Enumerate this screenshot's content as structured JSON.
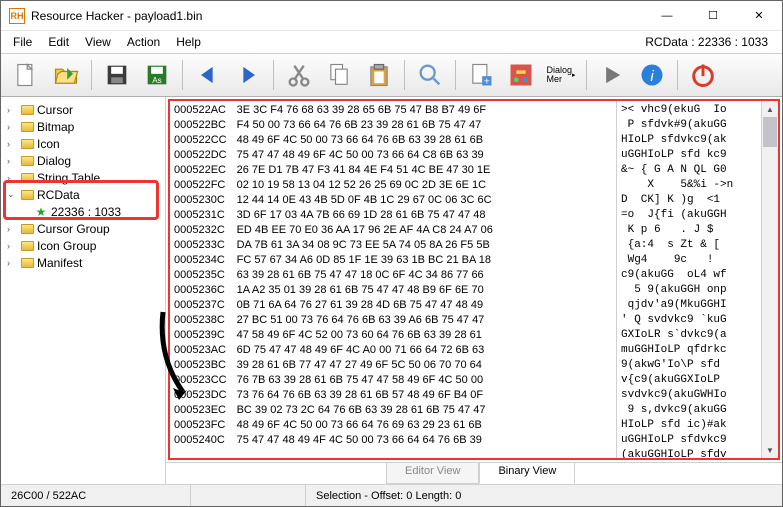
{
  "window": {
    "title": "Resource Hacker - payload1.bin",
    "path_right": "RCData : 22336 : 1033"
  },
  "menu": {
    "file": "File",
    "edit": "Edit",
    "view": "View",
    "action": "Action",
    "help": "Help"
  },
  "tree": {
    "items": [
      {
        "label": "Cursor"
      },
      {
        "label": "Bitmap"
      },
      {
        "label": "Icon"
      },
      {
        "label": "Dialog"
      },
      {
        "label": "String Table"
      },
      {
        "label": "RCData",
        "expanded": true,
        "children": [
          {
            "label": "22336 : 1033",
            "selected": true
          }
        ]
      },
      {
        "label": "Cursor Group"
      },
      {
        "label": "Icon Group"
      },
      {
        "label": "Manifest"
      }
    ]
  },
  "hex": {
    "addresses": [
      "000522AC",
      "000522BC",
      "000522CC",
      "000522DC",
      "000522EC",
      "000522FC",
      "0005230C",
      "0005231C",
      "0005232C",
      "0005233C",
      "0005234C",
      "0005235C",
      "0005236C",
      "0005237C",
      "0005238C",
      "0005239C",
      "000523AC",
      "000523BC",
      "000523CC",
      "000523DC",
      "000523EC",
      "000523FC",
      "0005240C"
    ],
    "bytes": [
      "3E 3C F4 76 68 63 39 28 65 6B 75 47 B8 B7 49 6F",
      "F4 50 00 73 66 64 76 6B 23 39 28 61 6B 75 47 47",
      "48 49 6F 4C 50 00 73 66 64 76 6B 63 39 28 61 6B",
      "75 47 47 48 49 6F 4C 50 00 73 66 64 C8 6B 63 39",
      "26 7E D1 7B 47 F3 41 84 4E F4 51 4C BE 47 30 1E",
      "02 10 19 58 13 04 12 52 26 25 69 0C 2D 3E 6E 1C",
      "12 44 14 0E 43 4B 5D 0F 4B 1C 29 67 0C 06 3C 6C",
      "3D 6F 17 03 4A 7B 66 69 1D 28 61 6B 75 47 47 48",
      "ED 4B EE 70 E0 36 AA 17 96 2E AF 4A C8 24 A7 06",
      "DA 7B 61 3A 34 08 9C 73 EE 5A 74 05 8A 26 F5 5B",
      "FC 57 67 34 A6 0D 85 1F 1E 39 63 1B BC 21 BA 18",
      "63 39 28 61 6B 75 47 47 18 0C 6F 4C 34 86 77 66",
      "1A A2 35 01 39 28 61 6B 75 47 47 48 B9 6F 6E 70",
      "0B 71 6A 64 76 27 61 39 28 4D 6B 75 47 47 48 49",
      "27 BC 51 00 73 76 64 76 6B 63 39 A6 6B 75 47 47",
      "47 58 49 6F 4C 52 00 73 60 64 76 6B 63 39 28 61",
      "6D 75 47 47 48 49 6F 4C A0 00 71 66 64 72 6B 63",
      "39 28 61 6B 77 47 47 27 49 6F 5C 50 06 70 70 64",
      "76 7B 63 39 28 61 6B 75 47 47 58 49 6F 4C 50 00",
      "73 76 64 76 6B 63 39 28 61 6B 57 48 49 6F B4 0F",
      "BC 39 02 73 2C 64 76 6B 63 39 28 61 6B 75 47 47",
      "48 49 6F 4C 50 00 73 66 64 76 69 63 29 23 61 6B",
      "75 47 47 48 49 4F 4C 50 00 73 66 64 64 76 6B 39"
    ],
    "ascii": ">< vhc9(ekuG  Io\n P sfdvk#9(akuGG\nHIoLP sfdvkc9(ak\nuGGHIoLP sfd kc9\n&~ { G A N QL G0\n    X    5&%i ->n\nD  CK] K )g  <1\n=o  J{fi (akuGGH\n K p 6   . J $  \n {a:4  s Zt & [\n Wg4    9c   !  \nc9(akuGG  oL4 wf\n  5 9(akuGGH onp\n qjdv'a9(MkuGGHI\n' Q svdvkc9 `kuG\nGXIoLR s`dvkc9(a\nmuGGHIoLP qfdrkc\n9(akwG'Io\\P sfd\nv{c9(akuGGXIoLP \nsvdvkc9(akuGWHIo\n 9 s,dvkc9(akuGG\nHIoLP sfd ic)#ak\nuGGHIoLP sfdvkc9\n(akuGGHIoLP sfdv"
  },
  "tabs": {
    "editor": "Editor View",
    "binary": "Binary View"
  },
  "status": {
    "left": "26C00 / 522AC",
    "sel": "Selection - Offset: 0 Length: 0"
  }
}
